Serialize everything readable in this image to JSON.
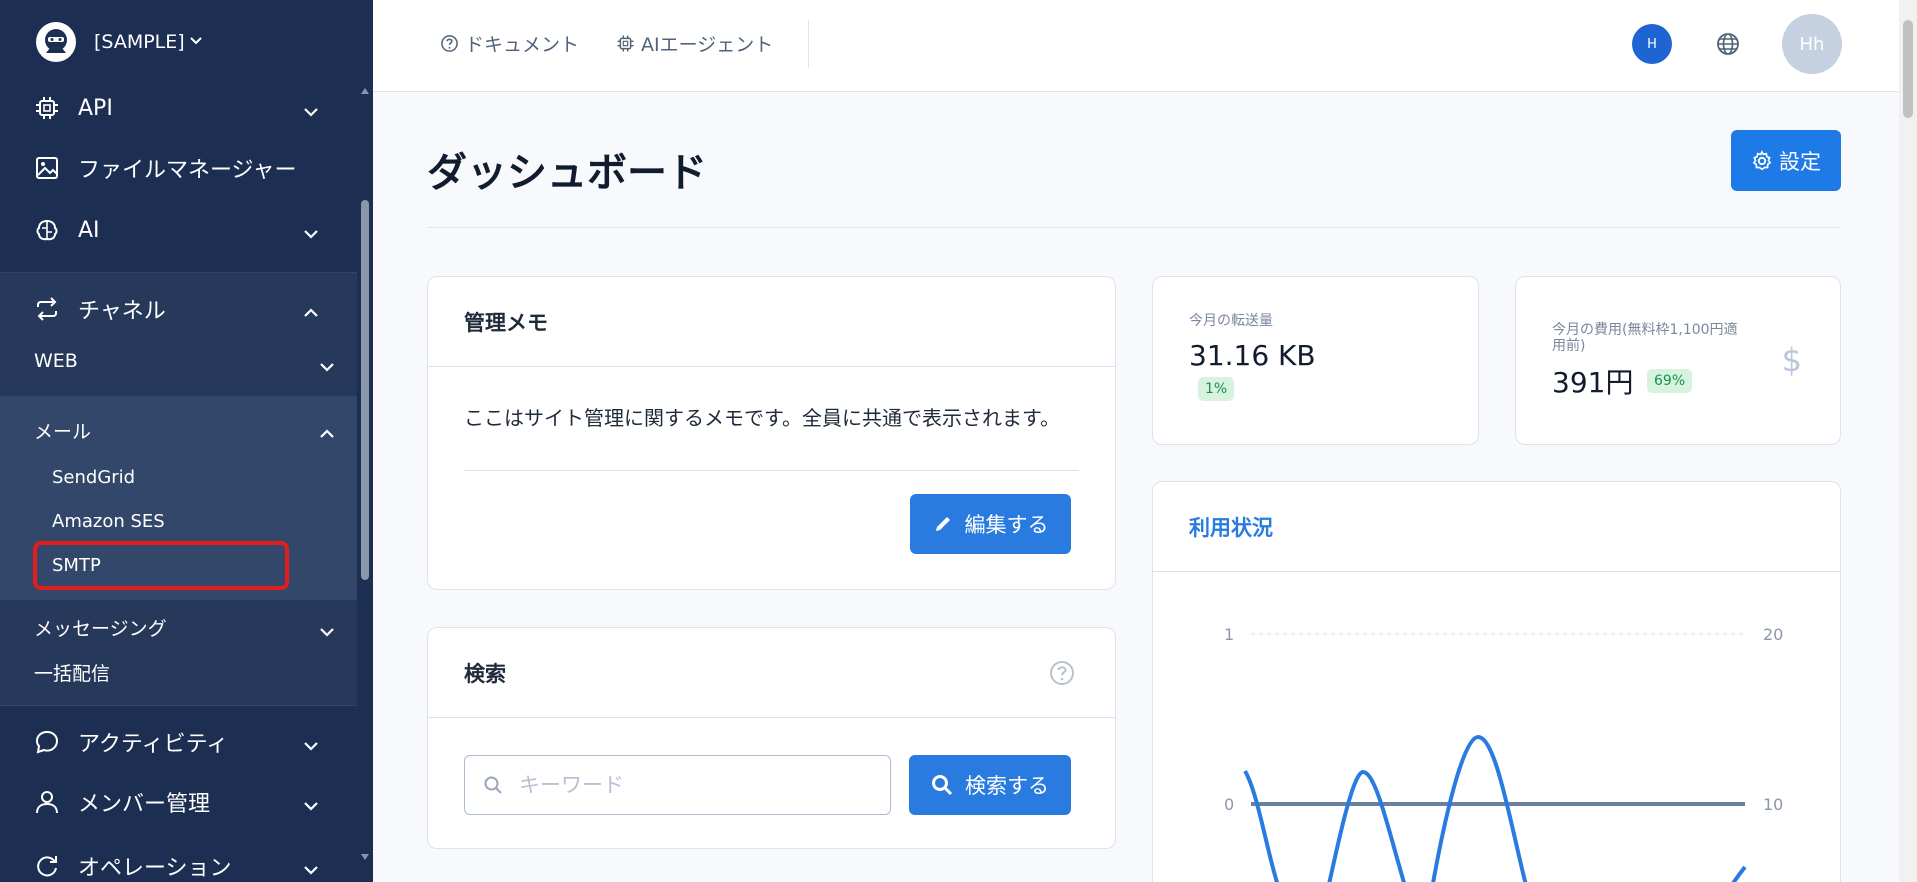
{
  "sidebar": {
    "brand": "[SAMPLE]",
    "items": [
      {
        "label": "API",
        "icon": "chip-icon"
      },
      {
        "label": "ファイルマネージャー",
        "icon": "image-icon"
      },
      {
        "label": "AI",
        "icon": "brain-icon"
      },
      {
        "label": "チャネル",
        "icon": "repeat-icon"
      },
      {
        "label": "アクティビティ",
        "icon": "chat-bubble-icon"
      },
      {
        "label": "メンバー管理",
        "icon": "user-icon"
      },
      {
        "label": "オペレーション",
        "icon": "refresh-icon"
      }
    ],
    "channel_sub": {
      "web": "WEB",
      "mail": "メール",
      "mail_items": [
        "SendGrid",
        "Amazon SES",
        "SMTP"
      ],
      "messaging": "メッセージング",
      "bulk": "一括配信"
    }
  },
  "header": {
    "docs": "ドキュメント",
    "ai_agent": "AIエージェント",
    "user_chip": "H",
    "avatar": "Hh"
  },
  "main": {
    "title": "ダッシュボード",
    "settings": "設定",
    "memo": {
      "title": "管理メモ",
      "text": "ここはサイト管理に関するメモです。全員に共通で表示されます。",
      "edit": "編集する"
    },
    "search": {
      "title": "検索",
      "placeholder": "キーワード",
      "button": "検索する"
    },
    "transfer": {
      "label": "今月の転送量",
      "value": "31.16 KB",
      "badge": "1%"
    },
    "cost": {
      "label_line1": "今月の費用(無料枠1,100円適",
      "label_line2": "用前)",
      "value": "391円",
      "badge": "69%",
      "icon": "$"
    },
    "usage": {
      "title": "利用状況"
    }
  },
  "colors": {
    "sidebar_bg": "#1c2f52",
    "accent": "#2a7be0",
    "highlight": "#e11d1d"
  },
  "chart_data": {
    "type": "line",
    "y_left_ticks": [
      "1",
      "0"
    ],
    "y_right_ticks": [
      "20",
      "10"
    ],
    "ylim_left": [
      0,
      1
    ],
    "ylim_right": [
      10,
      20
    ],
    "grid": true
  }
}
